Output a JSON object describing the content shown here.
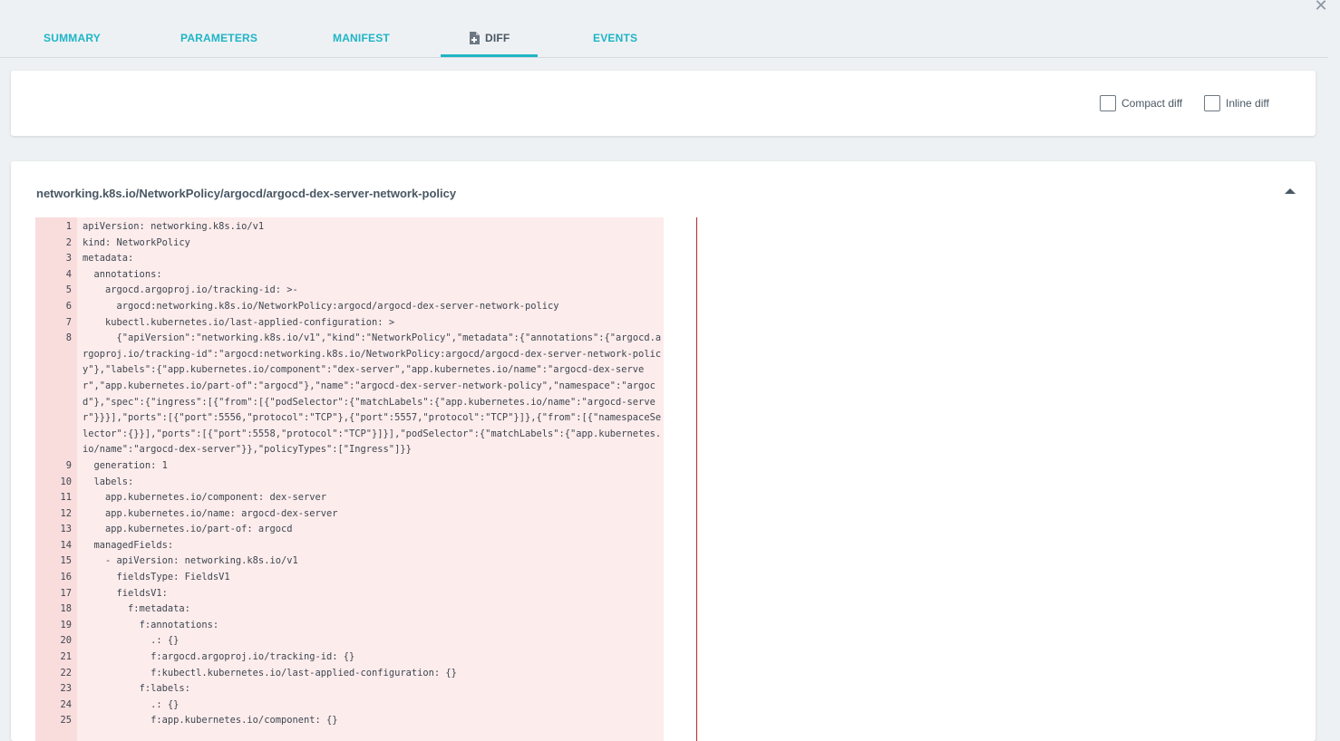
{
  "tabs": [
    {
      "label": "SUMMARY"
    },
    {
      "label": "PARAMETERS"
    },
    {
      "label": "MANIFEST"
    },
    {
      "label": "DIFF"
    },
    {
      "label": "EVENTS"
    }
  ],
  "active_tab": "DIFF",
  "options": {
    "compact_diff_label": "Compact diff",
    "compact_diff_checked": false,
    "inline_diff_label": "Inline diff",
    "inline_diff_checked": false
  },
  "diff": {
    "resource_title": "networking.k8s.io/NetworkPolicy/argocd/argocd-dex-server-network-policy",
    "lines": [
      {
        "no": "1",
        "text": "apiVersion: networking.k8s.io/v1"
      },
      {
        "no": "2",
        "text": "kind: NetworkPolicy"
      },
      {
        "no": "3",
        "text": "metadata:"
      },
      {
        "no": "4",
        "text": "  annotations:"
      },
      {
        "no": "5",
        "text": "    argocd.argoproj.io/tracking-id: >-"
      },
      {
        "no": "6",
        "text": "      argocd:networking.k8s.io/NetworkPolicy:argocd/argocd-dex-server-network-policy"
      },
      {
        "no": "7",
        "text": "    kubectl.kubernetes.io/last-applied-configuration: >"
      },
      {
        "no": "8",
        "text": "      {\"apiVersion\":\"networking.k8s.io/v1\",\"kind\":\"NetworkPolicy\",\"metadata\":{\"annotations\":{\"argocd.argoproj.io/tracking-id\":\"argocd:networking.k8s.io/NetworkPolicy:argocd/argocd-dex-server-network-policy\"},\"labels\":{\"app.kubernetes.io/component\":\"dex-server\",\"app.kubernetes.io/name\":\"argocd-dex-server\",\"app.kubernetes.io/part-of\":\"argocd\"},\"name\":\"argocd-dex-server-network-policy\",\"namespace\":\"argocd\"},\"spec\":{\"ingress\":[{\"from\":[{\"podSelector\":{\"matchLabels\":{\"app.kubernetes.io/name\":\"argocd-server\"}}}],\"ports\":[{\"port\":5556,\"protocol\":\"TCP\"},{\"port\":5557,\"protocol\":\"TCP\"}]},{\"from\":[{\"namespaceSelector\":{}}],\"ports\":[{\"port\":5558,\"protocol\":\"TCP\"}]}],\"podSelector\":{\"matchLabels\":{\"app.kubernetes.io/name\":\"argocd-dex-server\"}},\"policyTypes\":[\"Ingress\"]}}"
      },
      {
        "no": "9",
        "text": "  generation: 1"
      },
      {
        "no": "10",
        "text": "  labels:"
      },
      {
        "no": "11",
        "text": "    app.kubernetes.io/component: dex-server"
      },
      {
        "no": "12",
        "text": "    app.kubernetes.io/name: argocd-dex-server"
      },
      {
        "no": "13",
        "text": "    app.kubernetes.io/part-of: argocd"
      },
      {
        "no": "14",
        "text": "  managedFields:"
      },
      {
        "no": "15",
        "text": "    - apiVersion: networking.k8s.io/v1"
      },
      {
        "no": "16",
        "text": "      fieldsType: FieldsV1"
      },
      {
        "no": "17",
        "text": "      fieldsV1:"
      },
      {
        "no": "18",
        "text": "        f:metadata:"
      },
      {
        "no": "19",
        "text": "          f:annotations:"
      },
      {
        "no": "20",
        "text": "            .: {}"
      },
      {
        "no": "21",
        "text": "            f:argocd.argoproj.io/tracking-id: {}"
      },
      {
        "no": "22",
        "text": "            f:kubectl.kubernetes.io/last-applied-configuration: {}"
      },
      {
        "no": "23",
        "text": "          f:labels:"
      },
      {
        "no": "24",
        "text": "            .: {}"
      },
      {
        "no": "25",
        "text": "            f:app.kubernetes.io/component: {}"
      }
    ]
  },
  "icons": {
    "close": "close-icon",
    "diff_tab": "file-diff-icon",
    "collapse": "caret-up-icon"
  },
  "colors": {
    "accent": "#1fb5c6",
    "removed_bg": "#fdecec",
    "removed_gutter": "#f9dcdc",
    "split_line": "#b8252c"
  }
}
